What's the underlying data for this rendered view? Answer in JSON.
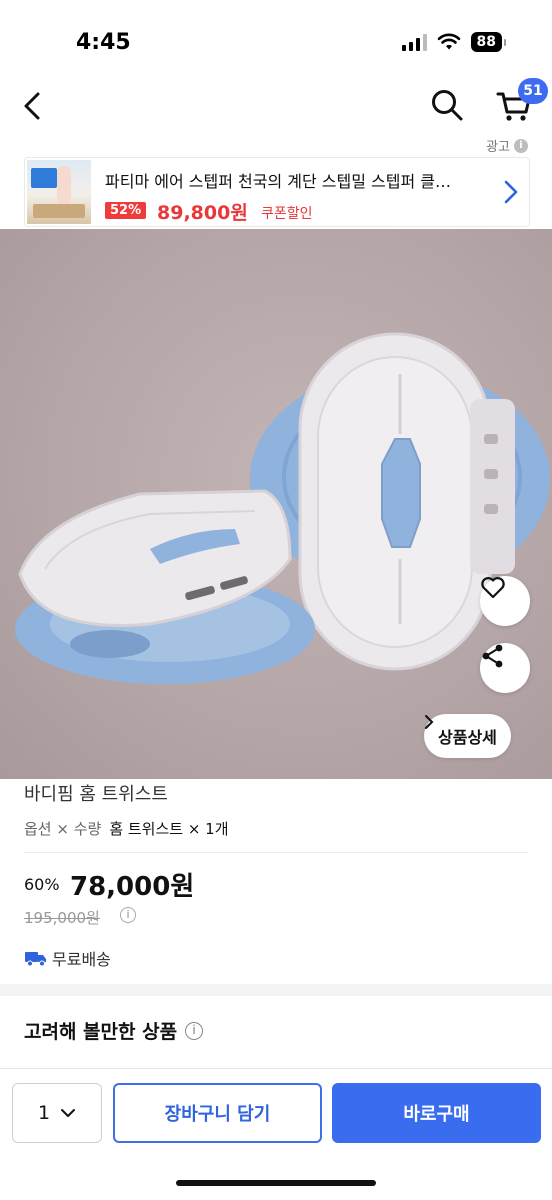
{
  "status_bar": {
    "time": "4:45",
    "battery": "88"
  },
  "header": {
    "cart_badge": "51"
  },
  "ad": {
    "label": "광고",
    "title": "파티마 에어 스텝퍼 천국의 계단 스텝밀 스텝퍼 클…",
    "discount": "52%",
    "price": "89,800원",
    "coupon": "쿠폰할인"
  },
  "product": {
    "detail_button": "상품상세",
    "name": "바디핌 홈 트위스트",
    "option_label": "옵션 × 수량",
    "option_value": "홈 트위스트 × 1개",
    "discount_rate": "60%",
    "sale_price": "78,000원",
    "original_price": "195,000원",
    "shipping": "무료배송"
  },
  "related": {
    "title": "고려해 볼만한 상품"
  },
  "bottom_bar": {
    "quantity": "1",
    "cart_button": "장바구니 담기",
    "buy_button": "바로구매"
  },
  "colors": {
    "accent": "#3a6cf0",
    "sale_red": "#e8383a",
    "product_blue": "#8fb3dc",
    "product_white": "#ece9ec"
  }
}
